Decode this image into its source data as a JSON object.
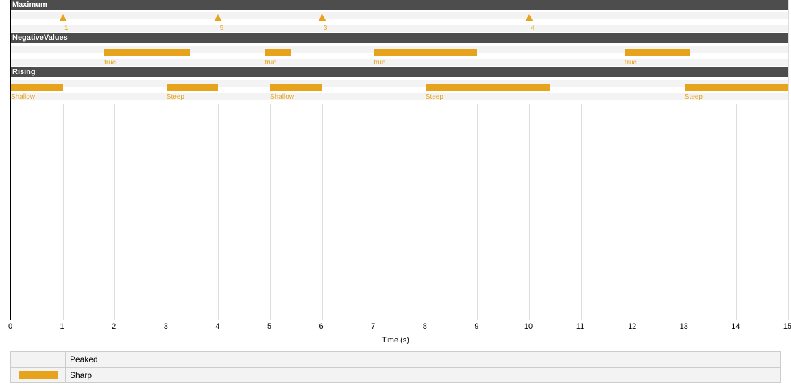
{
  "chart_data": {
    "type": "area",
    "xlabel": "Time (s)",
    "x_range": [
      0,
      15
    ],
    "x_ticks": [
      0,
      1,
      2,
      3,
      4,
      5,
      6,
      7,
      8,
      9,
      10,
      11,
      12,
      13,
      14,
      15
    ],
    "lanes": [
      {
        "name": "Maximum",
        "kind": "markers",
        "markers": [
          {
            "time": 1.0,
            "label": "1"
          },
          {
            "time": 4.0,
            "label": "5"
          },
          {
            "time": 6.0,
            "label": "3"
          },
          {
            "time": 10.0,
            "label": "4"
          }
        ]
      },
      {
        "name": "NegativeValues",
        "kind": "intervals",
        "intervals": [
          {
            "start": 1.8,
            "end": 3.45,
            "label": "true"
          },
          {
            "start": 4.9,
            "end": 5.4,
            "label": "true"
          },
          {
            "start": 7.0,
            "end": 9.0,
            "label": "true"
          },
          {
            "start": 11.85,
            "end": 13.1,
            "label": "true"
          }
        ]
      },
      {
        "name": "Rising",
        "kind": "intervals",
        "intervals": [
          {
            "start": 0.0,
            "end": 1.0,
            "label": "Shallow"
          },
          {
            "start": 3.0,
            "end": 4.0,
            "label": "Steep"
          },
          {
            "start": 5.0,
            "end": 6.0,
            "label": "Shallow"
          },
          {
            "start": 8.0,
            "end": 10.4,
            "label": "Steep"
          },
          {
            "start": 13.0,
            "end": 15.0,
            "label": "Steep"
          }
        ]
      }
    ],
    "legend": [
      {
        "swatch": null,
        "label": "Peaked"
      },
      {
        "swatch": "#e7a31b",
        "label": "Sharp"
      }
    ],
    "colors": {
      "interval": "#e7a31b",
      "header_bg": "#4d4d4d"
    }
  }
}
